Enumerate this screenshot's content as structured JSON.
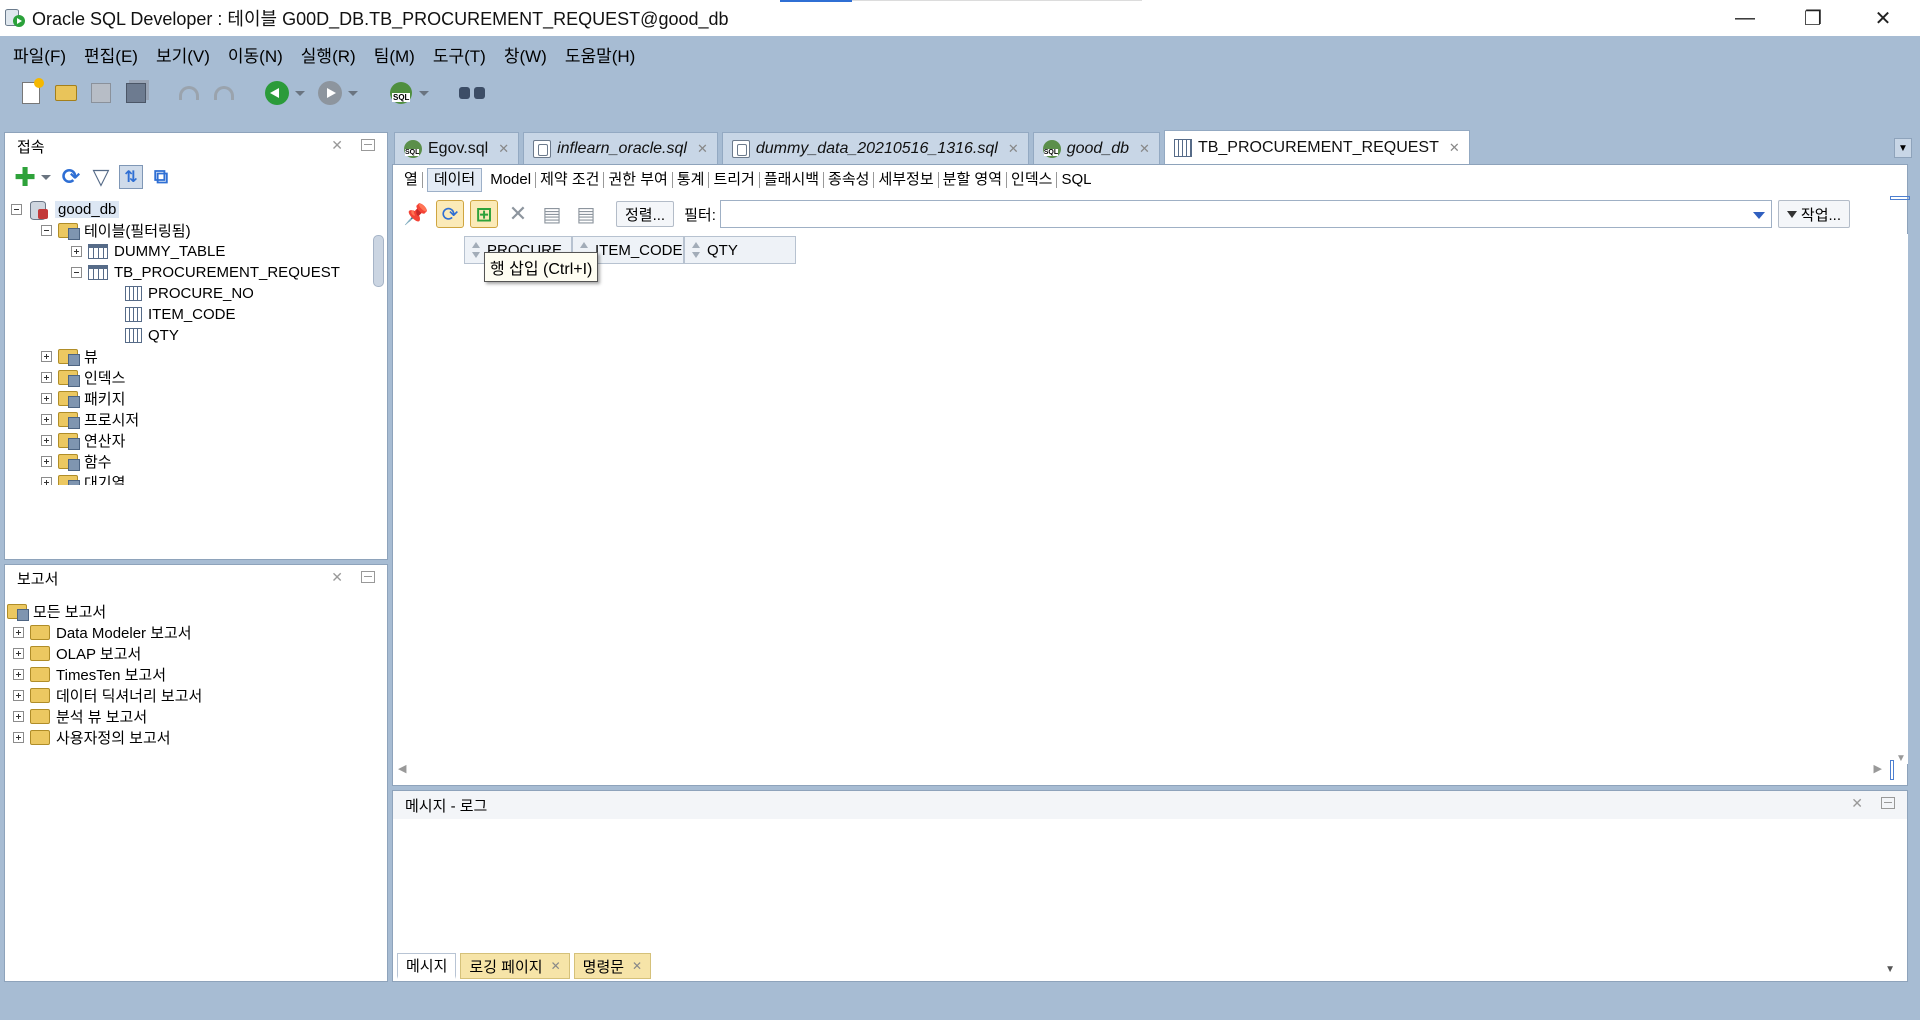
{
  "window": {
    "title": "Oracle SQL Developer : 테이블 G00D_DB.TB_PROCUREMENT_REQUEST@good_db",
    "minimize": "—",
    "restore": "❐",
    "close": "✕"
  },
  "menu": [
    "파일(F)",
    "편집(E)",
    "보기(V)",
    "이동(N)",
    "실행(R)",
    "팀(M)",
    "도구(T)",
    "창(W)",
    "도움말(H)"
  ],
  "connections": {
    "title": "접속",
    "root": "good_db",
    "tables_folder": "테이블(필터링됨)",
    "tables": [
      "DUMMY_TABLE",
      "TB_PROCUREMENT_REQUEST"
    ],
    "columns": [
      "PROCURE_NO",
      "ITEM_CODE",
      "QTY"
    ],
    "folders": [
      "뷰",
      "인덱스",
      "패키지",
      "프로시저",
      "연산자",
      "함수",
      "대기열"
    ]
  },
  "reports": {
    "title": "보고서",
    "root": "모든 보고서",
    "items": [
      "Data Modeler 보고서",
      "OLAP 보고서",
      "TimesTen 보고서",
      "데이터 딕셔너리 보고서",
      "분석 뷰 보고서",
      "사용자정의 보고서"
    ]
  },
  "editor_tabs": [
    {
      "label": "Egov.sql",
      "icon": "sql-worksheet-icon"
    },
    {
      "label": "inflearn_oracle.sql",
      "icon": "sql-file-icon"
    },
    {
      "label": "dummy_data_20210516_1316.sql",
      "icon": "sql-file-icon"
    },
    {
      "label": "good_db",
      "icon": "sql-worksheet-icon"
    },
    {
      "label": "TB_PROCUREMENT_REQUEST",
      "icon": "table-icon"
    }
  ],
  "sub_tabs": [
    "열",
    "데이터",
    "Model",
    "제약 조건",
    "권한 부여",
    "통계",
    "트리거",
    "플래시백",
    "종속성",
    "세부정보",
    "분할 영역",
    "인덱스",
    "SQL"
  ],
  "active_sub_tab": "데이터",
  "data_toolbar": {
    "sort_label": "정렬...",
    "filter_label": "필터:",
    "filter_value": "",
    "action_label": "작업..."
  },
  "grid": {
    "columns": [
      "PROCURE_NO",
      "ITEM_CODE",
      "QTY"
    ],
    "tooltip": "행 삽입 (Ctrl+I)"
  },
  "log": {
    "title": "메시지 - 로그",
    "tabs": [
      "메시지",
      "로깅 페이지",
      "명령문"
    ]
  },
  "colors": {
    "accent": "#2f6fd4",
    "chrome": "#a7bcd3",
    "tab_inactive": "#c8d6e6",
    "log_tab": "#f6e4a8"
  }
}
